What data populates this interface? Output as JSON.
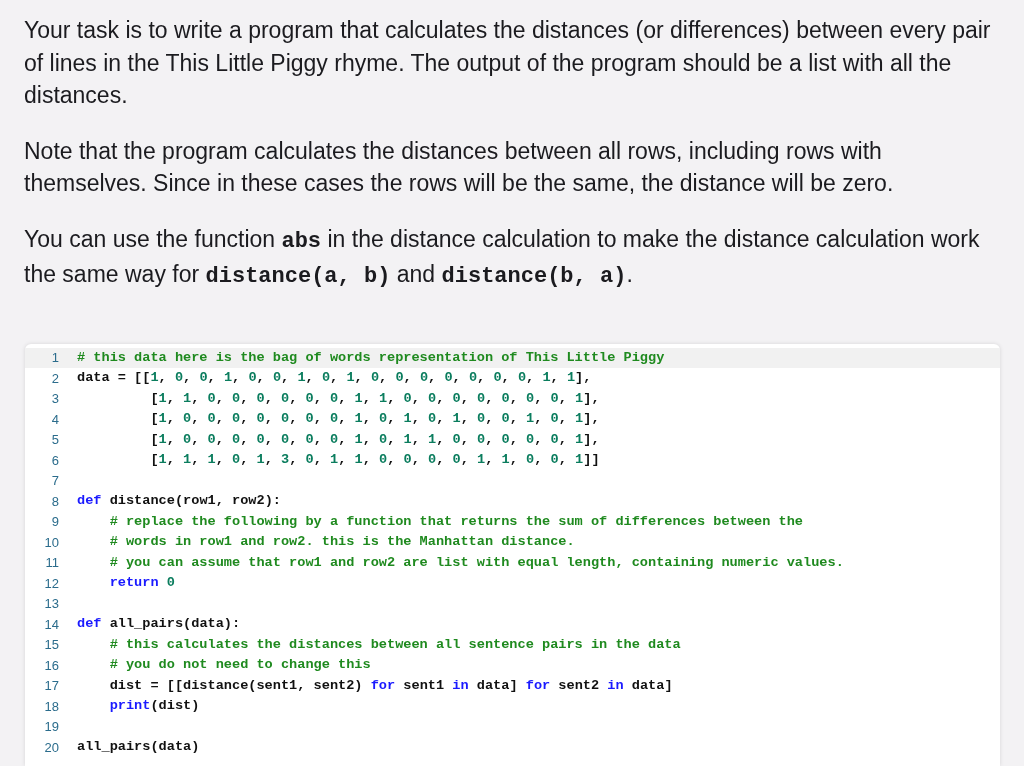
{
  "paragraphs": [
    [
      {
        "kind": "text",
        "text": "Your task is to write a program that calculates the distances (or differences) between every pair of lines in the This Little Piggy rhyme. The output of the program should be a list with all the distances."
      }
    ],
    [
      {
        "kind": "text",
        "text": "Note that the program calculates the distances between all rows, including rows with themselves. Since in these cases the rows will be the same, the distance will be zero."
      }
    ],
    [
      {
        "kind": "text",
        "text": "You can use the function "
      },
      {
        "kind": "code",
        "text": "abs"
      },
      {
        "kind": "text",
        "text": " in the distance calculation to make the distance calculation work the same way for "
      },
      {
        "kind": "code",
        "text": "distance(a, b)"
      },
      {
        "kind": "text",
        "text": " and "
      },
      {
        "kind": "code",
        "text": "distance(b, a)"
      },
      {
        "kind": "text",
        "text": "."
      }
    ]
  ],
  "editor": {
    "lines": [
      {
        "number": "1",
        "selected": true,
        "tokens": [
          {
            "kind": "comment",
            "text": "# this data here is the bag of words representation of This Little Piggy"
          }
        ]
      },
      {
        "number": "2",
        "selected": false,
        "tokens": [
          {
            "kind": "plain",
            "text": "data = [["
          },
          {
            "kind": "numlist",
            "text": "1, 0, 0, 1, 0, 0, 1, 0, 1, 0, 0, 0, 0, 0, 0, 0, 1, 1"
          },
          {
            "kind": "plain",
            "text": "],"
          }
        ]
      },
      {
        "number": "3",
        "selected": false,
        "tokens": [
          {
            "kind": "plain",
            "text": "         ["
          },
          {
            "kind": "numlist",
            "text": "1, 1, 0, 0, 0, 0, 0, 0, 1, 1, 0, 0, 0, 0, 0, 0, 0, 1"
          },
          {
            "kind": "plain",
            "text": "],"
          }
        ]
      },
      {
        "number": "4",
        "selected": false,
        "tokens": [
          {
            "kind": "plain",
            "text": "         ["
          },
          {
            "kind": "numlist",
            "text": "1, 0, 0, 0, 0, 0, 0, 0, 1, 0, 1, 0, 1, 0, 0, 1, 0, 1"
          },
          {
            "kind": "plain",
            "text": "],"
          }
        ]
      },
      {
        "number": "5",
        "selected": false,
        "tokens": [
          {
            "kind": "plain",
            "text": "         ["
          },
          {
            "kind": "numlist",
            "text": "1, 0, 0, 0, 0, 0, 0, 0, 1, 0, 1, 1, 0, 0, 0, 0, 0, 1"
          },
          {
            "kind": "plain",
            "text": "],"
          }
        ]
      },
      {
        "number": "6",
        "selected": false,
        "tokens": [
          {
            "kind": "plain",
            "text": "         ["
          },
          {
            "kind": "numlist",
            "text": "1, 1, 1, 0, 1, 3, 0, 1, 1, 0, 0, 0, 0, 1, 1, 0, 0, 1"
          },
          {
            "kind": "plain",
            "text": "]]"
          }
        ]
      },
      {
        "number": "7",
        "selected": false
      },
      {
        "number": "8",
        "selected": false,
        "tokens": [
          {
            "kind": "keyword",
            "text": "def"
          },
          {
            "kind": "plain",
            "text": " distance(row1, row2):"
          }
        ]
      },
      {
        "number": "9",
        "selected": false,
        "tokens": [
          {
            "kind": "comment",
            "text": "    # replace the following by a function that returns the sum of differences between the"
          }
        ]
      },
      {
        "number": "10",
        "selected": false,
        "tokens": [
          {
            "kind": "comment",
            "text": "    # words in row1 and row2. this is the Manhattan distance."
          }
        ]
      },
      {
        "number": "11",
        "selected": false,
        "tokens": [
          {
            "kind": "comment",
            "text": "    # you can assume that row1 and row2 are list with equal length, containing numeric values."
          }
        ]
      },
      {
        "number": "12",
        "selected": false,
        "tokens": [
          {
            "kind": "keyword",
            "text": "    return"
          },
          {
            "kind": "numlist",
            "text": " 0"
          }
        ]
      },
      {
        "number": "13",
        "selected": false
      },
      {
        "number": "14",
        "selected": false,
        "tokens": [
          {
            "kind": "keyword",
            "text": "def"
          },
          {
            "kind": "plain",
            "text": " all_pairs(data):"
          }
        ]
      },
      {
        "number": "15",
        "selected": false,
        "tokens": [
          {
            "kind": "comment",
            "text": "    # this calculates the distances between all sentence pairs in the data"
          }
        ]
      },
      {
        "number": "16",
        "selected": false,
        "tokens": [
          {
            "kind": "comment",
            "text": "    # you do not need to change this"
          }
        ]
      },
      {
        "number": "17",
        "selected": false,
        "tokens": [
          {
            "kind": "plain",
            "text": "    dist = [[distance(sent1, sent2) "
          },
          {
            "kind": "keyword",
            "text": "for"
          },
          {
            "kind": "plain",
            "text": " sent1 "
          },
          {
            "kind": "keyword",
            "text": "in"
          },
          {
            "kind": "plain",
            "text": " data] "
          },
          {
            "kind": "keyword",
            "text": "for"
          },
          {
            "kind": "plain",
            "text": " sent2 "
          },
          {
            "kind": "keyword",
            "text": "in"
          },
          {
            "kind": "plain",
            "text": " data]"
          }
        ]
      },
      {
        "number": "18",
        "selected": false,
        "tokens": [
          {
            "kind": "keyword",
            "text": "    print"
          },
          {
            "kind": "plain",
            "text": "(dist)"
          }
        ]
      },
      {
        "number": "19",
        "selected": false
      },
      {
        "number": "20",
        "selected": false,
        "tokens": [
          {
            "kind": "plain",
            "text": "all_pairs(data)"
          }
        ]
      }
    ]
  }
}
